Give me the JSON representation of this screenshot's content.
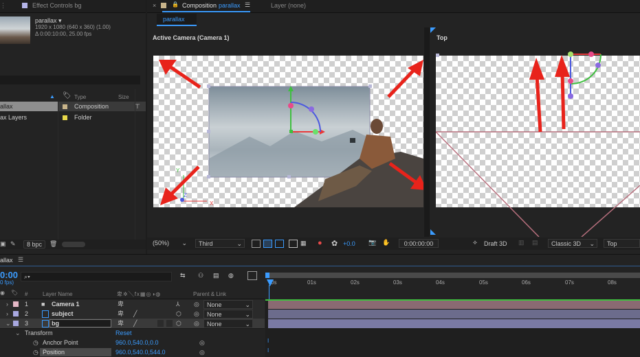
{
  "project_panel": {
    "tab_label": "Effect Controls bg",
    "comp_name": "parallax ▾",
    "comp_size": "1920 x 1080  (640 x 360) (1.00)",
    "comp_duration": "Δ 0:00:10:00, 25.00 fps",
    "col_type": "Type",
    "col_size": "Size",
    "items": [
      {
        "name": "allax",
        "type": "Composition",
        "color": "#c8b48a"
      },
      {
        "name": "ax Layers",
        "type": "Folder",
        "color": "#e8d84a"
      }
    ],
    "bpc": "8 bpc"
  },
  "comp_panel": {
    "tab_close": "×",
    "tab_label": "Composition",
    "tab_comp": "parallax",
    "tab_menu": "☰",
    "layer_tab": "Layer (none)",
    "subtab": "parallax",
    "active_camera_label": "Active Camera (Camera 1)",
    "top_label": "Top"
  },
  "viewer_toolbar": {
    "zoom": "(50%)",
    "resolution": "Third",
    "exposure": "+0.0",
    "timecode": "0:00:00:00",
    "draft3d": "Draft 3D",
    "renderer": "Classic 3D",
    "view": "Top"
  },
  "timeline": {
    "tab_label": "allax",
    "tab_menu": "☰",
    "timecode": "0:00",
    "fps": "0 fps)",
    "search_placeholder": "⌕▾",
    "col_hash": "#",
    "col_layer_name": "Layer Name",
    "col_switches": "卑✲╲fx▦◎◑◍",
    "col_parent": "Parent & Link",
    "ticks": [
      "0s",
      "01s",
      "02s",
      "03s",
      "04s",
      "05s",
      "06s",
      "07s",
      "08s"
    ],
    "layers": [
      {
        "num": "1",
        "name": "Camera 1",
        "color": "#e5b8c6",
        "parent": "None"
      },
      {
        "num": "2",
        "name": "subject",
        "color": "#a8a8e0",
        "parent": "None"
      },
      {
        "num": "3",
        "name": "bg",
        "color": "#a8a8e0",
        "parent": "None"
      }
    ],
    "transform_label": "Transform",
    "transform_reset": "Reset",
    "properties": [
      {
        "name": "Anchor Point",
        "value": "960.0,540.0,0.0"
      },
      {
        "name": "Position",
        "value": "960.0,540.0,544.0"
      }
    ]
  },
  "colors": {
    "accent": "#3b9cff",
    "arrow": "#e8231b",
    "camera_track": "#8a6a72",
    "layer_track": "#6c6c8c"
  }
}
